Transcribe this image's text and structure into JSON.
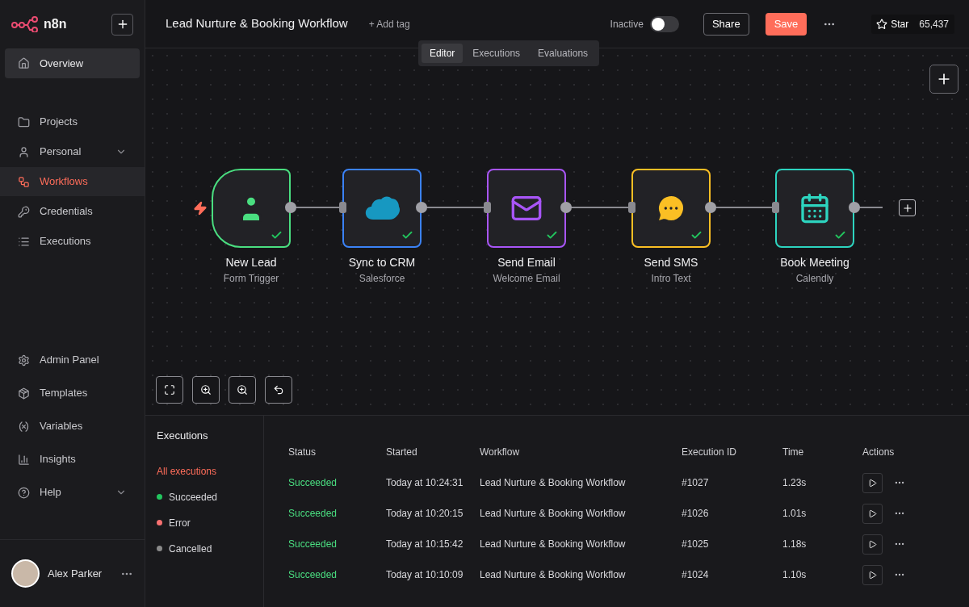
{
  "brand": {
    "name": "n8n"
  },
  "sidebar": {
    "overview": {
      "label": "Overview",
      "selected": true
    },
    "items": [
      {
        "label": "Projects",
        "kind": "folder",
        "selected": false,
        "expandable": false
      },
      {
        "label": "Personal",
        "kind": "user",
        "selected": false,
        "expandable": true
      },
      {
        "label": "Workflows",
        "kind": "workflow",
        "selected": true,
        "expandable": false
      },
      {
        "label": "Credentials",
        "kind": "key",
        "selected": false,
        "expandable": false
      },
      {
        "label": "Executions",
        "kind": "list",
        "selected": false,
        "expandable": false
      }
    ],
    "bottom_items": [
      {
        "label": "Admin Panel",
        "kind": "gear",
        "expandable": false
      },
      {
        "label": "Templates",
        "kind": "box",
        "expandable": false
      },
      {
        "label": "Variables",
        "kind": "variable",
        "expandable": false
      },
      {
        "label": "Insights",
        "kind": "chart",
        "expandable": false
      },
      {
        "label": "Help",
        "kind": "help",
        "expandable": true
      }
    ],
    "user": {
      "name": "Alex Parker"
    }
  },
  "header": {
    "title": "Lead Nurture & Booking Workflow",
    "add_tag": "+ Add tag",
    "status_label": "Inactive",
    "active": false,
    "share": "Share",
    "save": "Save",
    "star": "Star",
    "star_count": "65,437"
  },
  "tabs": [
    {
      "label": "Editor",
      "selected": true
    },
    {
      "label": "Executions",
      "selected": false
    },
    {
      "label": "Evaluations",
      "selected": false
    }
  ],
  "nodes": [
    {
      "title": "New Lead",
      "subtitle": "Form Trigger",
      "kind": "trigger",
      "color": "#4ade80",
      "success": true
    },
    {
      "title": "Sync to CRM",
      "subtitle": "Salesforce",
      "kind": "crm",
      "color": "#3b82f6",
      "success": true
    },
    {
      "title": "Send Email",
      "subtitle": "Welcome Email",
      "kind": "email",
      "color": "#a855f7",
      "success": true
    },
    {
      "title": "Send SMS",
      "subtitle": "Intro Text",
      "kind": "sms",
      "color": "#fbbf24",
      "success": true
    },
    {
      "title": "Book Meeting",
      "subtitle": "Calendly",
      "kind": "calendar",
      "color": "#2dd4bf",
      "success": true
    }
  ],
  "executions_panel": {
    "title": "Executions",
    "filters": [
      {
        "label": "All executions",
        "selected": true
      },
      {
        "label": "Succeeded",
        "selected": false,
        "color": "#22c55e"
      },
      {
        "label": "Error",
        "selected": false,
        "color": "#f87171"
      },
      {
        "label": "Cancelled",
        "selected": false,
        "color": "#8a8a8a"
      }
    ],
    "columns": [
      "Status",
      "Started",
      "Workflow",
      "Execution ID",
      "Time",
      "Actions"
    ],
    "rows": [
      {
        "status": "Succeeded",
        "started": "Today at 10:24:31",
        "workflow": "Lead Nurture & Booking Workflow",
        "id": "#1027",
        "time": "1.23s"
      },
      {
        "status": "Succeeded",
        "started": "Today at 10:20:15",
        "workflow": "Lead Nurture & Booking Workflow",
        "id": "#1026",
        "time": "1.01s"
      },
      {
        "status": "Succeeded",
        "started": "Today at 10:15:42",
        "workflow": "Lead Nurture & Booking Workflow",
        "id": "#1025",
        "time": "1.18s"
      },
      {
        "status": "Succeeded",
        "started": "Today at 10:10:09",
        "workflow": "Lead Nurture & Booking Workflow",
        "id": "#1024",
        "time": "1.10s"
      }
    ]
  }
}
